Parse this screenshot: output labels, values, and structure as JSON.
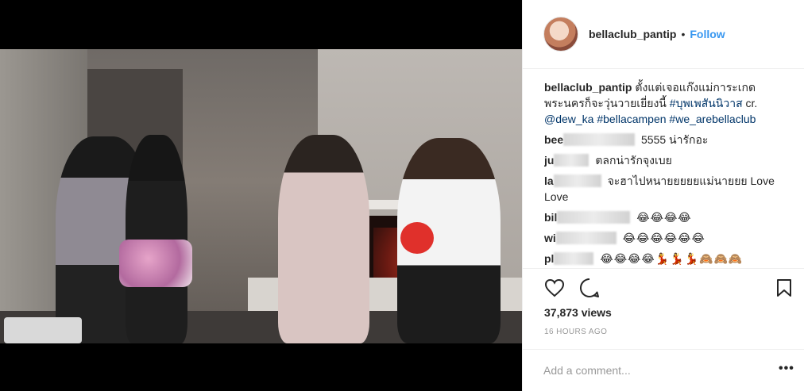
{
  "post": {
    "username": "bellaclub_pantip",
    "separator": "•",
    "follow_label": "Follow",
    "caption": {
      "username": "bellaclub_pantip",
      "text": "ตั้งแต่เจอแก๊งแม่การะเกด พระนครก็จะวุ่นวายเยี่ยงนี้",
      "hashtag1": "#บุพเพสันนิวาส",
      "cr": "cr.",
      "mention": "@dew_ka",
      "hashtag2": "#bellacampen",
      "hashtag3": "#we_arebellaclub"
    },
    "comments": [
      {
        "user_visible": "bee",
        "text": "5555 น่ารักอะ"
      },
      {
        "user_visible": "ju",
        "text": "ตลกน่ารักจุงเบย"
      },
      {
        "user_visible": "la",
        "text": "จะฮาไปหนายยยยยแม่นายยย Love Love"
      },
      {
        "user_visible": "bil",
        "text": "😂😂😂😂"
      },
      {
        "user_visible": "wi",
        "text": "😂😂😂😂😂😂"
      },
      {
        "user_visible": "pl",
        "text": "😂😂😂😂💃💃💃🙈🙈🙈"
      }
    ],
    "views": "37,873 views",
    "timestamp": "16 HOURS AGO",
    "add_comment_placeholder": "Add a comment...",
    "more_label": "•••"
  }
}
